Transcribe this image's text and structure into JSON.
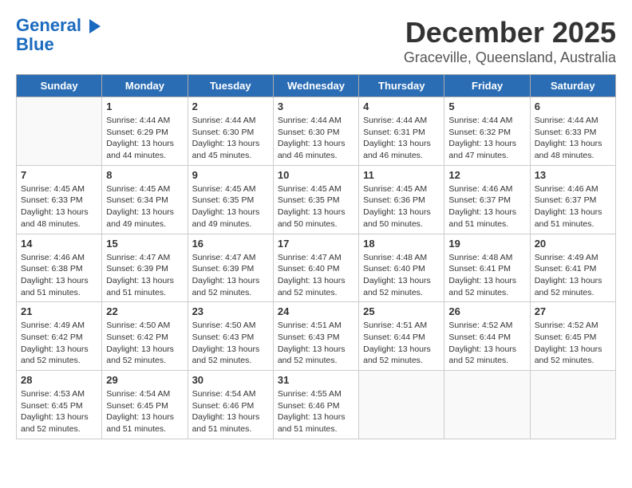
{
  "logo": {
    "line1": "General",
    "line2": "Blue"
  },
  "title": "December 2025",
  "subtitle": "Graceville, Queensland, Australia",
  "headers": [
    "Sunday",
    "Monday",
    "Tuesday",
    "Wednesday",
    "Thursday",
    "Friday",
    "Saturday"
  ],
  "weeks": [
    [
      {
        "day": "",
        "detail": ""
      },
      {
        "day": "1",
        "detail": "Sunrise: 4:44 AM\nSunset: 6:29 PM\nDaylight: 13 hours\nand 44 minutes."
      },
      {
        "day": "2",
        "detail": "Sunrise: 4:44 AM\nSunset: 6:30 PM\nDaylight: 13 hours\nand 45 minutes."
      },
      {
        "day": "3",
        "detail": "Sunrise: 4:44 AM\nSunset: 6:30 PM\nDaylight: 13 hours\nand 46 minutes."
      },
      {
        "day": "4",
        "detail": "Sunrise: 4:44 AM\nSunset: 6:31 PM\nDaylight: 13 hours\nand 46 minutes."
      },
      {
        "day": "5",
        "detail": "Sunrise: 4:44 AM\nSunset: 6:32 PM\nDaylight: 13 hours\nand 47 minutes."
      },
      {
        "day": "6",
        "detail": "Sunrise: 4:44 AM\nSunset: 6:33 PM\nDaylight: 13 hours\nand 48 minutes."
      }
    ],
    [
      {
        "day": "7",
        "detail": "Sunrise: 4:45 AM\nSunset: 6:33 PM\nDaylight: 13 hours\nand 48 minutes."
      },
      {
        "day": "8",
        "detail": "Sunrise: 4:45 AM\nSunset: 6:34 PM\nDaylight: 13 hours\nand 49 minutes."
      },
      {
        "day": "9",
        "detail": "Sunrise: 4:45 AM\nSunset: 6:35 PM\nDaylight: 13 hours\nand 49 minutes."
      },
      {
        "day": "10",
        "detail": "Sunrise: 4:45 AM\nSunset: 6:35 PM\nDaylight: 13 hours\nand 50 minutes."
      },
      {
        "day": "11",
        "detail": "Sunrise: 4:45 AM\nSunset: 6:36 PM\nDaylight: 13 hours\nand 50 minutes."
      },
      {
        "day": "12",
        "detail": "Sunrise: 4:46 AM\nSunset: 6:37 PM\nDaylight: 13 hours\nand 51 minutes."
      },
      {
        "day": "13",
        "detail": "Sunrise: 4:46 AM\nSunset: 6:37 PM\nDaylight: 13 hours\nand 51 minutes."
      }
    ],
    [
      {
        "day": "14",
        "detail": "Sunrise: 4:46 AM\nSunset: 6:38 PM\nDaylight: 13 hours\nand 51 minutes."
      },
      {
        "day": "15",
        "detail": "Sunrise: 4:47 AM\nSunset: 6:39 PM\nDaylight: 13 hours\nand 51 minutes."
      },
      {
        "day": "16",
        "detail": "Sunrise: 4:47 AM\nSunset: 6:39 PM\nDaylight: 13 hours\nand 52 minutes."
      },
      {
        "day": "17",
        "detail": "Sunrise: 4:47 AM\nSunset: 6:40 PM\nDaylight: 13 hours\nand 52 minutes."
      },
      {
        "day": "18",
        "detail": "Sunrise: 4:48 AM\nSunset: 6:40 PM\nDaylight: 13 hours\nand 52 minutes."
      },
      {
        "day": "19",
        "detail": "Sunrise: 4:48 AM\nSunset: 6:41 PM\nDaylight: 13 hours\nand 52 minutes."
      },
      {
        "day": "20",
        "detail": "Sunrise: 4:49 AM\nSunset: 6:41 PM\nDaylight: 13 hours\nand 52 minutes."
      }
    ],
    [
      {
        "day": "21",
        "detail": "Sunrise: 4:49 AM\nSunset: 6:42 PM\nDaylight: 13 hours\nand 52 minutes."
      },
      {
        "day": "22",
        "detail": "Sunrise: 4:50 AM\nSunset: 6:42 PM\nDaylight: 13 hours\nand 52 minutes."
      },
      {
        "day": "23",
        "detail": "Sunrise: 4:50 AM\nSunset: 6:43 PM\nDaylight: 13 hours\nand 52 minutes."
      },
      {
        "day": "24",
        "detail": "Sunrise: 4:51 AM\nSunset: 6:43 PM\nDaylight: 13 hours\nand 52 minutes."
      },
      {
        "day": "25",
        "detail": "Sunrise: 4:51 AM\nSunset: 6:44 PM\nDaylight: 13 hours\nand 52 minutes."
      },
      {
        "day": "26",
        "detail": "Sunrise: 4:52 AM\nSunset: 6:44 PM\nDaylight: 13 hours\nand 52 minutes."
      },
      {
        "day": "27",
        "detail": "Sunrise: 4:52 AM\nSunset: 6:45 PM\nDaylight: 13 hours\nand 52 minutes."
      }
    ],
    [
      {
        "day": "28",
        "detail": "Sunrise: 4:53 AM\nSunset: 6:45 PM\nDaylight: 13 hours\nand 52 minutes."
      },
      {
        "day": "29",
        "detail": "Sunrise: 4:54 AM\nSunset: 6:45 PM\nDaylight: 13 hours\nand 51 minutes."
      },
      {
        "day": "30",
        "detail": "Sunrise: 4:54 AM\nSunset: 6:46 PM\nDaylight: 13 hours\nand 51 minutes."
      },
      {
        "day": "31",
        "detail": "Sunrise: 4:55 AM\nSunset: 6:46 PM\nDaylight: 13 hours\nand 51 minutes."
      },
      {
        "day": "",
        "detail": ""
      },
      {
        "day": "",
        "detail": ""
      },
      {
        "day": "",
        "detail": ""
      }
    ]
  ]
}
